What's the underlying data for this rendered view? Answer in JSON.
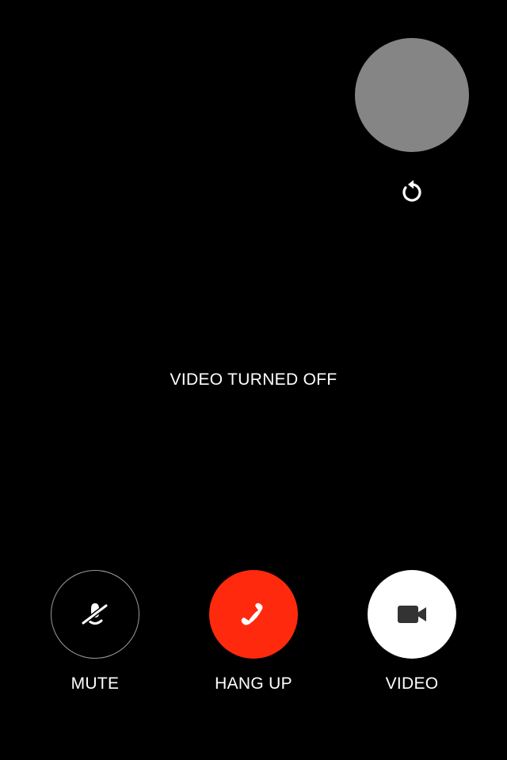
{
  "status": {
    "text": "VIDEO TURNED OFF"
  },
  "preview": {
    "color": "#858585",
    "switch_icon": "rotate-camera-icon"
  },
  "controls": {
    "mute": {
      "label": "MUTE",
      "icon": "microphone-off-icon"
    },
    "hangup": {
      "label": "HANG UP",
      "icon": "phone-hangup-icon",
      "color": "#ff2a0d"
    },
    "video": {
      "label": "VIDEO",
      "icon": "video-camera-icon"
    }
  }
}
